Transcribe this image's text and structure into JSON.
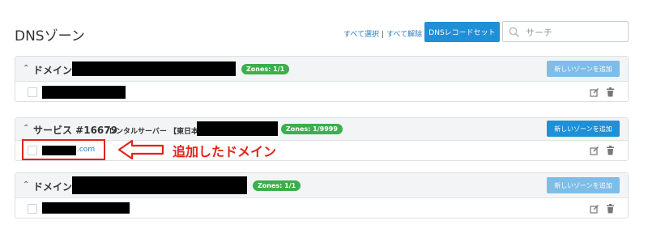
{
  "page_title": "DNSゾーン",
  "toolbar": {
    "select_all": "すべて選択",
    "deselect_all": "すべて解除",
    "dns_record_set_label": "DNSレコードセット",
    "search_placeholder": "サーチ"
  },
  "panels": [
    {
      "title": "ドメイン",
      "badge": "Zones: 1/1",
      "new_zone_label": "新しいゾーンを追加",
      "rows": [
        {
          "domain_text": ""
        }
      ]
    },
    {
      "title": "サービス #16679",
      "subtitle": "レンタルサーバー 【東日本】",
      "badge": "Zones: 1/9999",
      "new_zone_label": "新しいゾーンを追加",
      "rows": [
        {
          "domain_text": ".com"
        }
      ]
    },
    {
      "title": "ドメイン",
      "badge": "Zones: 1/1",
      "new_zone_label": "新しいゾーンを追加",
      "rows": [
        {
          "domain_text": ""
        }
      ]
    }
  ],
  "annotation": {
    "text": "追加したドメイン",
    "color": "#e2231a"
  },
  "colors": {
    "primary": "#1f8fd6",
    "primary_light": "#7dbde8",
    "badge_green": "#3cae4c",
    "link": "#2f7ab8"
  },
  "icons": [
    "search-icon",
    "edit-icon",
    "trash-icon",
    "collapse-caret-icon",
    "arrow-left-icon"
  ]
}
